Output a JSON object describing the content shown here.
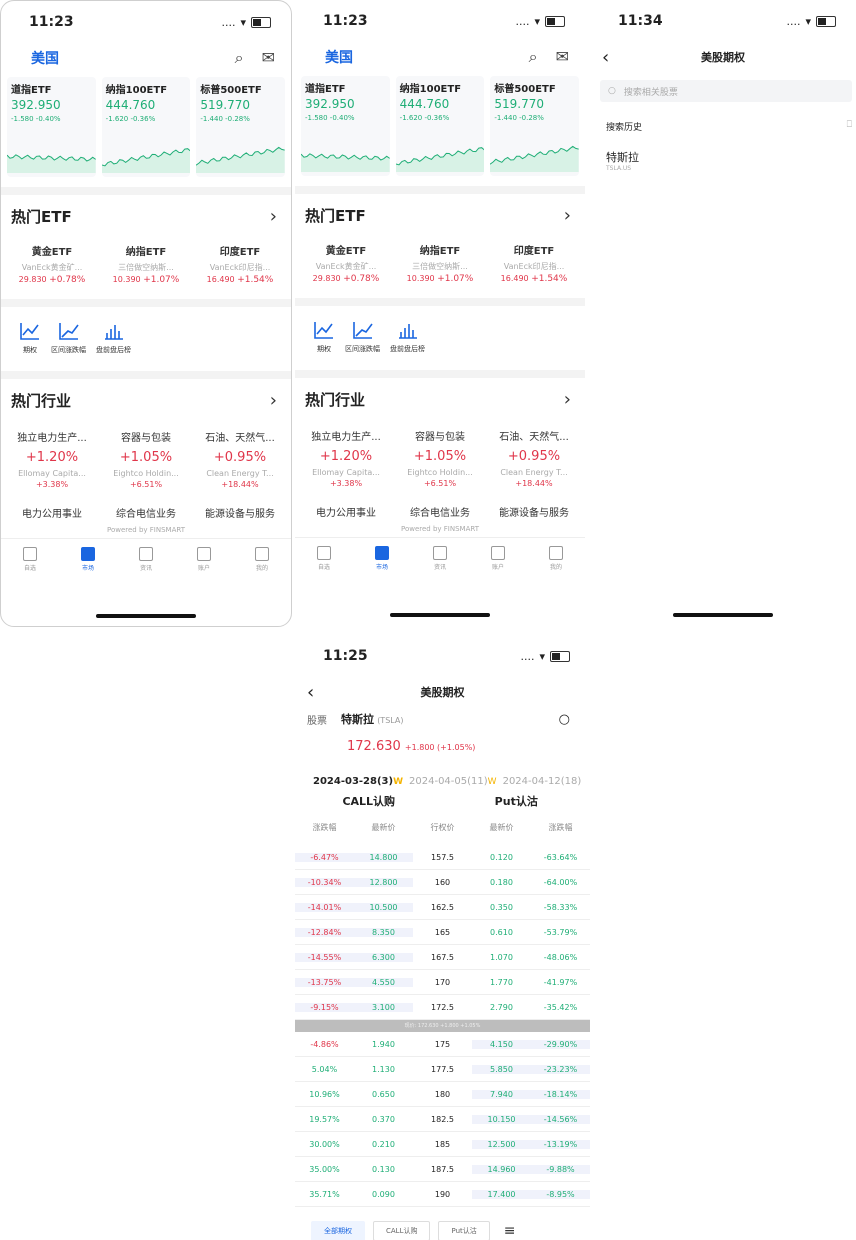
{
  "colors": {
    "up": "#e0364a",
    "down": "#1fae76",
    "accent": "#1a66e0"
  },
  "p1": {
    "time": "11:23",
    "signal": "....",
    "region": "美国",
    "indices": [
      {
        "name": "道指ETF",
        "price": "392.950",
        "chg": "-1.580 -0.40%"
      },
      {
        "name": "纳指100ETF",
        "price": "444.760",
        "chg": "-1.620 -0.36%"
      },
      {
        "name": "标普500ETF",
        "price": "519.770",
        "chg": "-1.440 -0.28%"
      }
    ],
    "hot_etf_title": "热门ETF",
    "etfs": [
      {
        "name": "黄金ETF",
        "sub": "VanEck黄金矿...",
        "price": "29.830",
        "chg": "+0.78%"
      },
      {
        "name": "纳指ETF",
        "sub": "三倍做空纳斯...",
        "price": "10.390",
        "chg": "+1.07%"
      },
      {
        "name": "印度ETF",
        "sub": "VanEck印尼指...",
        "price": "16.490",
        "chg": "+1.54%"
      }
    ],
    "tools": [
      "期权",
      "区间涨跌幅",
      "盘前盘后榜"
    ],
    "hot_ind_title": "热门行业",
    "industries": [
      {
        "name": "独立电力生产...",
        "chg": "+1.20%",
        "sub": "Ellomay Capita...",
        "sub_chg": "+3.38%"
      },
      {
        "name": "容器与包装",
        "chg": "+1.05%",
        "sub": "Eightco Holdin...",
        "sub_chg": "+6.51%"
      },
      {
        "name": "石油、天然气...",
        "chg": "+0.95%",
        "sub": "Clean Energy T...",
        "sub_chg": "+18.44%"
      }
    ],
    "industries2": [
      "电力公用事业",
      "综合电信业务",
      "能源设备与服务"
    ],
    "powered": "Powered by FINSMART",
    "tabs": [
      "自选",
      "市场",
      "资讯",
      "账户",
      "我的"
    ]
  },
  "p2": {
    "time": "11:23",
    "signal": "....",
    "region": "美国",
    "indices": [
      {
        "name": "道指ETF",
        "price": "392.950",
        "chg": "-1.580 -0.40%"
      },
      {
        "name": "纳指100ETF",
        "price": "444.760",
        "chg": "-1.620 -0.36%"
      },
      {
        "name": "标普500ETF",
        "price": "519.770",
        "chg": "-1.440 -0.28%"
      }
    ],
    "hot_etf_title": "热门ETF",
    "etfs": [
      {
        "name": "黄金ETF",
        "sub": "VanEck黄金矿...",
        "price": "29.830",
        "chg": "+0.78%"
      },
      {
        "name": "纳指ETF",
        "sub": "三倍做空纳斯...",
        "price": "10.390",
        "chg": "+1.07%"
      },
      {
        "name": "印度ETF",
        "sub": "VanEck印尼指...",
        "price": "16.490",
        "chg": "+1.54%"
      }
    ],
    "tools": [
      "期权",
      "区间涨跌幅",
      "盘前盘后榜"
    ],
    "hot_ind_title": "热门行业",
    "industries": [
      {
        "name": "独立电力生产...",
        "chg": "+1.20%",
        "sub": "Ellomay Capita...",
        "sub_chg": "+3.38%"
      },
      {
        "name": "容器与包装",
        "chg": "+1.05%",
        "sub": "Eightco Holdin...",
        "sub_chg": "+6.51%"
      },
      {
        "name": "石油、天然气...",
        "chg": "+0.95%",
        "sub": "Clean Energy T...",
        "sub_chg": "+18.44%"
      }
    ],
    "industries2": [
      "电力公用事业",
      "综合电信业务",
      "能源设备与服务"
    ],
    "powered": "Powered by FINSMART",
    "tabs": [
      "自选",
      "市场",
      "资讯",
      "账户",
      "我的"
    ]
  },
  "p3": {
    "time": "11:34",
    "signal": "....",
    "title": "美股期权",
    "search_placeholder": "搜索相关股票",
    "history_label": "搜索历史",
    "item_name": "特斯拉",
    "item_code": "TSLA.US"
  },
  "p4": {
    "time": "11:25",
    "signal": "....",
    "title": "美股期权",
    "stock_label": "股票",
    "stock_name": "特斯拉",
    "stock_code": "(TSLA)",
    "price": "172.630",
    "price_chg": "+1.800 (+1.05%)",
    "dates": [
      {
        "label": "2024-03-28(3)",
        "w": "W"
      },
      {
        "label": "2024-04-05(11)",
        "w": "W"
      },
      {
        "label": "2024-04-12(18)",
        "w": ""
      }
    ],
    "call_title": "CALL认购",
    "put_title": "Put认沽",
    "columns": [
      "涨跌幅",
      "最新价",
      "行权价",
      "最新价",
      "涨跌幅"
    ],
    "rows_above": [
      [
        "-6.47%",
        "14.800",
        "157.5",
        "0.120",
        "-63.64%"
      ],
      [
        "-10.34%",
        "12.800",
        "160",
        "0.180",
        "-64.00%"
      ],
      [
        "-14.01%",
        "10.500",
        "162.5",
        "0.350",
        "-58.33%"
      ],
      [
        "-12.84%",
        "8.350",
        "165",
        "0.610",
        "-53.79%"
      ],
      [
        "-14.55%",
        "6.300",
        "167.5",
        "1.070",
        "-48.06%"
      ],
      [
        "-13.75%",
        "4.550",
        "170",
        "1.770",
        "-41.97%"
      ],
      [
        "-9.15%",
        "3.100",
        "172.5",
        "2.790",
        "-35.42%"
      ]
    ],
    "current_price_bar": "现价: 172.630 +1.800 +1.05%",
    "rows_below": [
      [
        "-4.86%",
        "1.940",
        "175",
        "4.150",
        "-29.90%"
      ],
      [
        "5.04%",
        "1.130",
        "177.5",
        "5.850",
        "-23.23%"
      ],
      [
        "10.96%",
        "0.650",
        "180",
        "7.940",
        "-18.14%"
      ],
      [
        "19.57%",
        "0.370",
        "182.5",
        "10.150",
        "-14.56%"
      ],
      [
        "30.00%",
        "0.210",
        "185",
        "12.500",
        "-13.19%"
      ],
      [
        "35.00%",
        "0.130",
        "187.5",
        "14.960",
        "-9.88%"
      ],
      [
        "35.71%",
        "0.090",
        "190",
        "17.400",
        "-8.95%"
      ]
    ],
    "bottom_tabs": [
      "全部期权",
      "CALL认购",
      "Put认沽"
    ]
  }
}
